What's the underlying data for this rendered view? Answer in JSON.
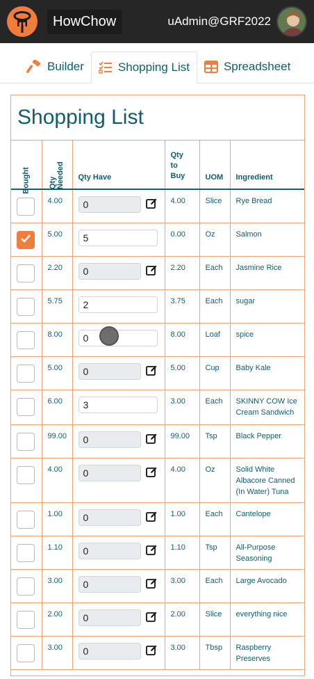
{
  "app": {
    "brand": "HowChow",
    "user": "uAdmin@GRF2022"
  },
  "tabs": [
    {
      "label": "Builder",
      "icon": "hammer-icon"
    },
    {
      "label": "Shopping List",
      "icon": "checklist-icon"
    },
    {
      "label": "Spreadsheet",
      "icon": "table-icon"
    }
  ],
  "page": {
    "title": "Shopping List"
  },
  "columns": {
    "bought": "Bought",
    "qty_needed": "Qty Needed",
    "qty_have": "Qty Have",
    "qty_to_buy": "Qty to Buy",
    "uom": "UOM",
    "ingredient": "Ingredient"
  },
  "colors": {
    "accent": "#f07d3c",
    "teal": "#115d6b",
    "topbar": "#262626"
  },
  "rows": [
    {
      "bought": false,
      "needed": "4.00",
      "have": "0",
      "have_editable": false,
      "to_buy": "4.00",
      "uom": "Slice",
      "ingredient": "Rye Bread"
    },
    {
      "bought": true,
      "needed": "5.00",
      "have": "5",
      "have_editable": true,
      "to_buy": "0.00",
      "uom": "Oz",
      "ingredient": "Salmon"
    },
    {
      "bought": false,
      "needed": "2.20",
      "have": "0",
      "have_editable": false,
      "to_buy": "2.20",
      "uom": "Each",
      "ingredient": "Jasmine Rice"
    },
    {
      "bought": false,
      "needed": "5.75",
      "have": "2",
      "have_editable": true,
      "to_buy": "3.75",
      "uom": "Each",
      "ingredient": "sugar"
    },
    {
      "bought": false,
      "needed": "8.00",
      "have": "0",
      "have_editable": true,
      "to_buy": "8.00",
      "uom": "Loaf",
      "ingredient": "spice"
    },
    {
      "bought": false,
      "needed": "5.00",
      "have": "0",
      "have_editable": false,
      "to_buy": "5.00",
      "uom": "Cup",
      "ingredient": "Baby Kale"
    },
    {
      "bought": false,
      "needed": "6.00",
      "have": "3",
      "have_editable": true,
      "to_buy": "3.00",
      "uom": "Each",
      "ingredient": "SKINNY COW Ice Cream Sandwich"
    },
    {
      "bought": false,
      "needed": "99.00",
      "have": "0",
      "have_editable": false,
      "to_buy": "99.00",
      "uom": "Tsp",
      "ingredient": "Black Pepper"
    },
    {
      "bought": false,
      "needed": "4.00",
      "have": "0",
      "have_editable": false,
      "to_buy": "4.00",
      "uom": "Oz",
      "ingredient": "Solid White Albacore Canned (In Water) Tuna"
    },
    {
      "bought": false,
      "needed": "1.00",
      "have": "0",
      "have_editable": false,
      "to_buy": "1.00",
      "uom": "Each",
      "ingredient": "Cantelope"
    },
    {
      "bought": false,
      "needed": "1.10",
      "have": "0",
      "have_editable": false,
      "to_buy": "1.10",
      "uom": "Tsp",
      "ingredient": "All-Purpose Seasoning"
    },
    {
      "bought": false,
      "needed": "3.00",
      "have": "0",
      "have_editable": false,
      "to_buy": "3.00",
      "uom": "Each",
      "ingredient": "Large Avocado"
    },
    {
      "bought": false,
      "needed": "2.00",
      "have": "0",
      "have_editable": false,
      "to_buy": "2.00",
      "uom": "Slice",
      "ingredient": "everything nice"
    },
    {
      "bought": false,
      "needed": "3.00",
      "have": "0",
      "have_editable": false,
      "to_buy": "3.00",
      "uom": "Tbsp",
      "ingredient": "Raspberry Preserves"
    }
  ]
}
